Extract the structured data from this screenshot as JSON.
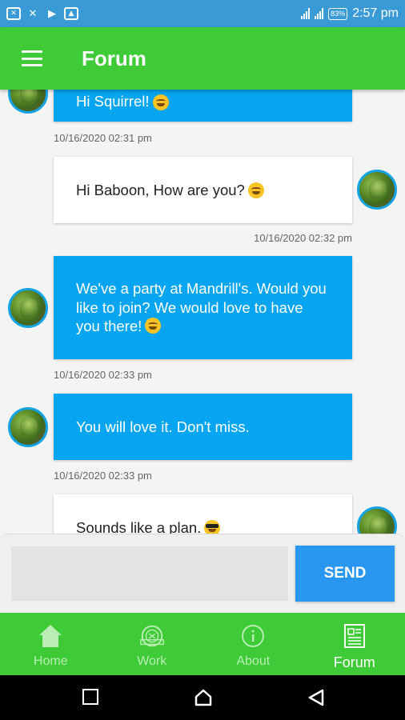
{
  "status_bar": {
    "battery": "83%",
    "time": "2:57 pm"
  },
  "app_bar": {
    "title": "Forum"
  },
  "messages": [
    {
      "text": "Hi Squirrel!",
      "timestamp": "10/16/2020 02:31 pm",
      "side": "incoming",
      "emoji": "smile"
    },
    {
      "text": "Hi Baboon, How are you?",
      "timestamp": "10/16/2020 02:32 pm",
      "side": "outgoing",
      "emoji": "smile"
    },
    {
      "text": "We've a party at Mandrill's. Would you like to join? We would love to have you there!",
      "timestamp": "10/16/2020 02:33 pm",
      "side": "incoming",
      "emoji": "grin"
    },
    {
      "text": "You will love it. Don't miss.",
      "timestamp": "10/16/2020 02:33 pm",
      "side": "incoming",
      "emoji": ""
    },
    {
      "text": "Sounds like a plan.",
      "timestamp": "",
      "side": "outgoing",
      "emoji": "sunglasses"
    }
  ],
  "composer": {
    "value": "",
    "placeholder": "",
    "send_label": "SEND"
  },
  "bottom_nav": {
    "items": [
      {
        "label": "Home",
        "icon": "home-icon",
        "active": false
      },
      {
        "label": "Work",
        "icon": "work-badge-icon",
        "active": false
      },
      {
        "label": "About",
        "icon": "info-icon",
        "active": false
      },
      {
        "label": "Forum",
        "icon": "forum-icon",
        "active": true
      }
    ]
  },
  "colors": {
    "app_bar": "#3fcb37",
    "status_bar": "#3a9ad6",
    "incoming_bubble": "#05a5f1",
    "outgoing_bubble": "#ffffff",
    "send_button": "#2996ef"
  }
}
